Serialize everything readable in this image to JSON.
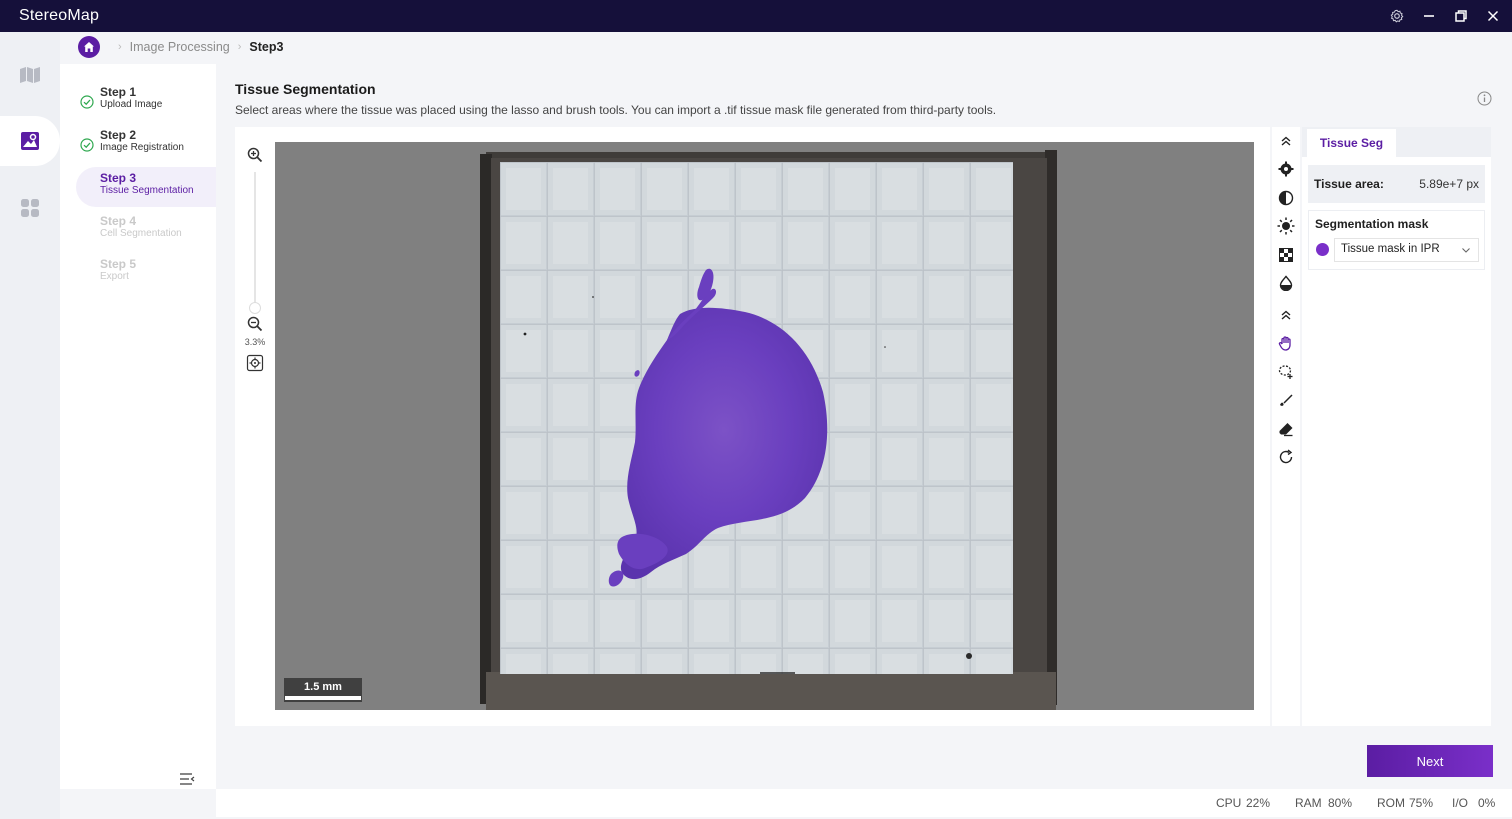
{
  "app": {
    "title": "StereoMap"
  },
  "breadcrumb": {
    "parent": "Image Processing",
    "current": "Step3"
  },
  "steps": [
    {
      "title": "Step 1",
      "subtitle": "Upload Image",
      "state": "done"
    },
    {
      "title": "Step 2",
      "subtitle": "Image Registration",
      "state": "done"
    },
    {
      "title": "Step 3",
      "subtitle": "Tissue Segmentation",
      "state": "active"
    },
    {
      "title": "Step 4",
      "subtitle": "Cell Segmentation",
      "state": "pending"
    },
    {
      "title": "Step 5",
      "subtitle": "Export",
      "state": "pending"
    }
  ],
  "main": {
    "title": "Tissue Segmentation",
    "description": "Select areas where the tissue was placed using the lasso and brush tools. You can import a .tif tissue mask file generated from third-party tools."
  },
  "viewer": {
    "zoom_level": "3.3%",
    "scale_label": "1.5 mm"
  },
  "panel": {
    "tab": "Tissue Seg",
    "tissue_area_label": "Tissue area:",
    "tissue_area_value": "5.89e+7 px",
    "mask_title": "Segmentation mask",
    "mask_selected": "Tissue mask in IPR",
    "mask_color": "#7a2fc9"
  },
  "actions": {
    "next_label": "Next"
  },
  "status": {
    "cpu_label": "CPU",
    "cpu_value": "22%",
    "ram_label": "RAM",
    "ram_value": "80%",
    "rom_label": "ROM",
    "rom_value": "75%",
    "io_label": "I/O",
    "io_value": "0%"
  },
  "colors": {
    "accent": "#5b1da3",
    "titlebar": "#15103a",
    "tissue": "#6a3fbf"
  }
}
